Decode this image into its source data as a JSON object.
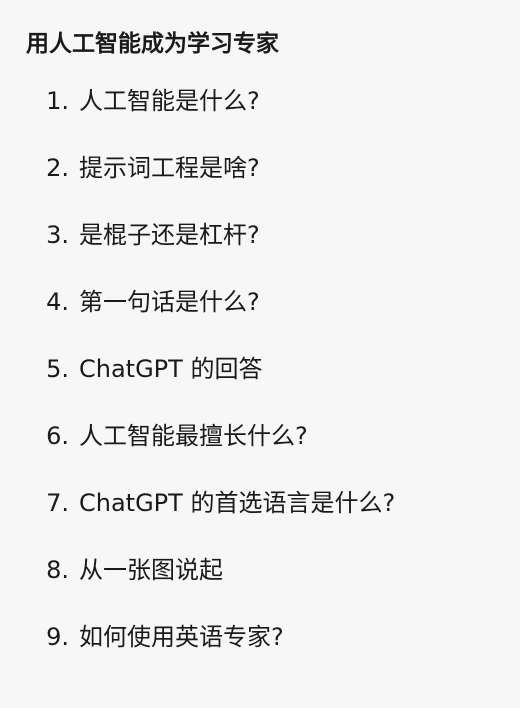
{
  "title": "用人工智能成为学习专家",
  "items": [
    {
      "num": "1.",
      "text": "人工智能是什么?"
    },
    {
      "num": "2.",
      "text": "提示词工程是啥?"
    },
    {
      "num": "3.",
      "text": "是棍子还是杠杆?"
    },
    {
      "num": "4.",
      "text": "第一句话是什么?"
    },
    {
      "num": "5.",
      "text": "ChatGPT 的回答"
    },
    {
      "num": "6.",
      "text": "人工智能最擅长什么?"
    },
    {
      "num": "7.",
      "text": "ChatGPT 的首选语言是什么?"
    },
    {
      "num": "8.",
      "text": "从一张图说起"
    },
    {
      "num": "9.",
      "text": "如何使用英语专家?"
    }
  ]
}
